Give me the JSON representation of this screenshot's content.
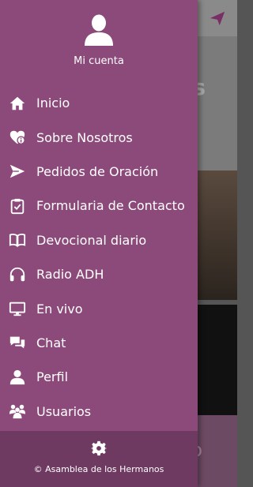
{
  "account": {
    "label": "Mi cuenta",
    "icon": "user-avatar-icon"
  },
  "menu": [
    {
      "label": "Inicio",
      "icon": "home-icon"
    },
    {
      "label": "Sobre Nosotros",
      "icon": "heart-info-icon"
    },
    {
      "label": "Pedidos de Oración",
      "icon": "paper-plane-icon"
    },
    {
      "label": "Formularia de Contacto",
      "icon": "clipboard-check-icon"
    },
    {
      "label": "Devocional diario",
      "icon": "open-book-icon"
    },
    {
      "label": "Radio ADH",
      "icon": "headphones-icon"
    },
    {
      "label": "En vivo",
      "icon": "monitor-icon"
    },
    {
      "label": "Chat",
      "icon": "chat-bubbles-icon"
    },
    {
      "label": "Perfil",
      "icon": "person-icon"
    },
    {
      "label": "Usuarios",
      "icon": "users-group-icon"
    }
  ],
  "footer": {
    "copyright": "© Asamblea de los Hermanos",
    "icon": "gear-icon"
  },
  "colors": {
    "drawer": "#8c4a7a",
    "footer": "#6f3a61",
    "text": "#ffffff"
  }
}
